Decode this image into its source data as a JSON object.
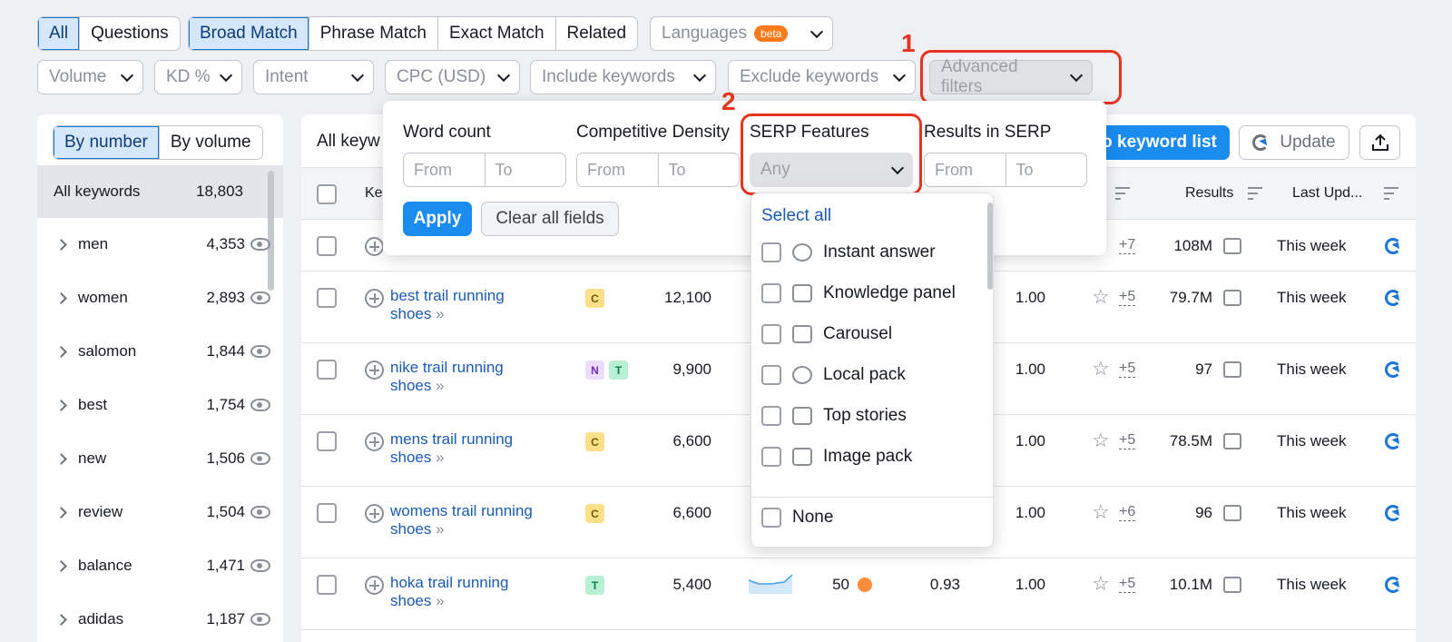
{
  "tabs_left": [
    "All",
    "Questions"
  ],
  "tabs_match": [
    "Broad Match",
    "Phrase Match",
    "Exact Match",
    "Related"
  ],
  "languages": {
    "label": "Languages",
    "badge": "beta"
  },
  "filters": {
    "volume": "Volume",
    "kd": "KD %",
    "intent": "Intent",
    "cpc": "CPC (USD)",
    "include": "Include keywords",
    "exclude": "Exclude keywords",
    "advanced": "Advanced filters"
  },
  "annotations": {
    "one": "1",
    "two": "2"
  },
  "sidebar": {
    "toggle": [
      "By number",
      "By volume"
    ],
    "all_label": "All keywords",
    "all_count": "18,803",
    "groups": [
      {
        "label": "men",
        "count": "4,353"
      },
      {
        "label": "women",
        "count": "2,893"
      },
      {
        "label": "salomon",
        "count": "1,844"
      },
      {
        "label": "best",
        "count": "1,754"
      },
      {
        "label": "new",
        "count": "1,506"
      },
      {
        "label": "review",
        "count": "1,504"
      },
      {
        "label": "balance",
        "count": "1,471"
      },
      {
        "label": "adidas",
        "count": "1,187"
      }
    ]
  },
  "main": {
    "title_partial": "All keyw",
    "add_list_partial": "o keyword list",
    "update": "Update",
    "col_keyword_partial": "Ke",
    "col_results": "Results",
    "col_last_update": "Last Upd...",
    "first_row": {
      "more": "+7",
      "results": "108M",
      "updated": "This week"
    },
    "rows": [
      {
        "kw1": "best trail running",
        "kw2": "shoes",
        "intents": [
          "C"
        ],
        "volume": "12,100",
        "com": "1.00",
        "more": "+5",
        "results": "79.7M",
        "updated": "This week"
      },
      {
        "kw1": "nike trail running",
        "kw2": "shoes",
        "intents": [
          "N",
          "T"
        ],
        "volume": "9,900",
        "com": "1.00",
        "more": "+5",
        "results": "97",
        "updated": "This week"
      },
      {
        "kw1": "mens trail running",
        "kw2": "shoes",
        "intents": [
          "C"
        ],
        "volume": "6,600",
        "com": "1.00",
        "more": "+5",
        "results": "78.5M",
        "updated": "This week"
      },
      {
        "kw1": "womens trail running",
        "kw2": "shoes",
        "intents": [
          "C"
        ],
        "volume": "6,600",
        "com": "1.00",
        "more": "+6",
        "results": "96",
        "updated": "This week"
      },
      {
        "kw1": "hoka trail running",
        "kw2": "shoes",
        "intents": [
          "T"
        ],
        "volume": "5,400",
        "kd": "50",
        "cpc": "0.93",
        "com": "1.00",
        "more": "+5",
        "results": "10.1M",
        "updated": "This week"
      }
    ]
  },
  "advanced_popup": {
    "word_count": "Word count",
    "competitive_density": "Competitive Density",
    "serp_features": "SERP Features",
    "results_in_serp": "Results in SERP",
    "from": "From",
    "to": "To",
    "any": "Any",
    "apply": "Apply",
    "clear": "Clear all fields"
  },
  "serp_list": {
    "select_all": "Select all",
    "items": [
      "Instant answer",
      "Knowledge panel",
      "Carousel",
      "Local pack",
      "Top stories",
      "Image pack"
    ],
    "none": "None"
  },
  "colors": {
    "accent": "#1a8cf0",
    "annotation": "#e8331f",
    "link": "#1a5bb8"
  }
}
